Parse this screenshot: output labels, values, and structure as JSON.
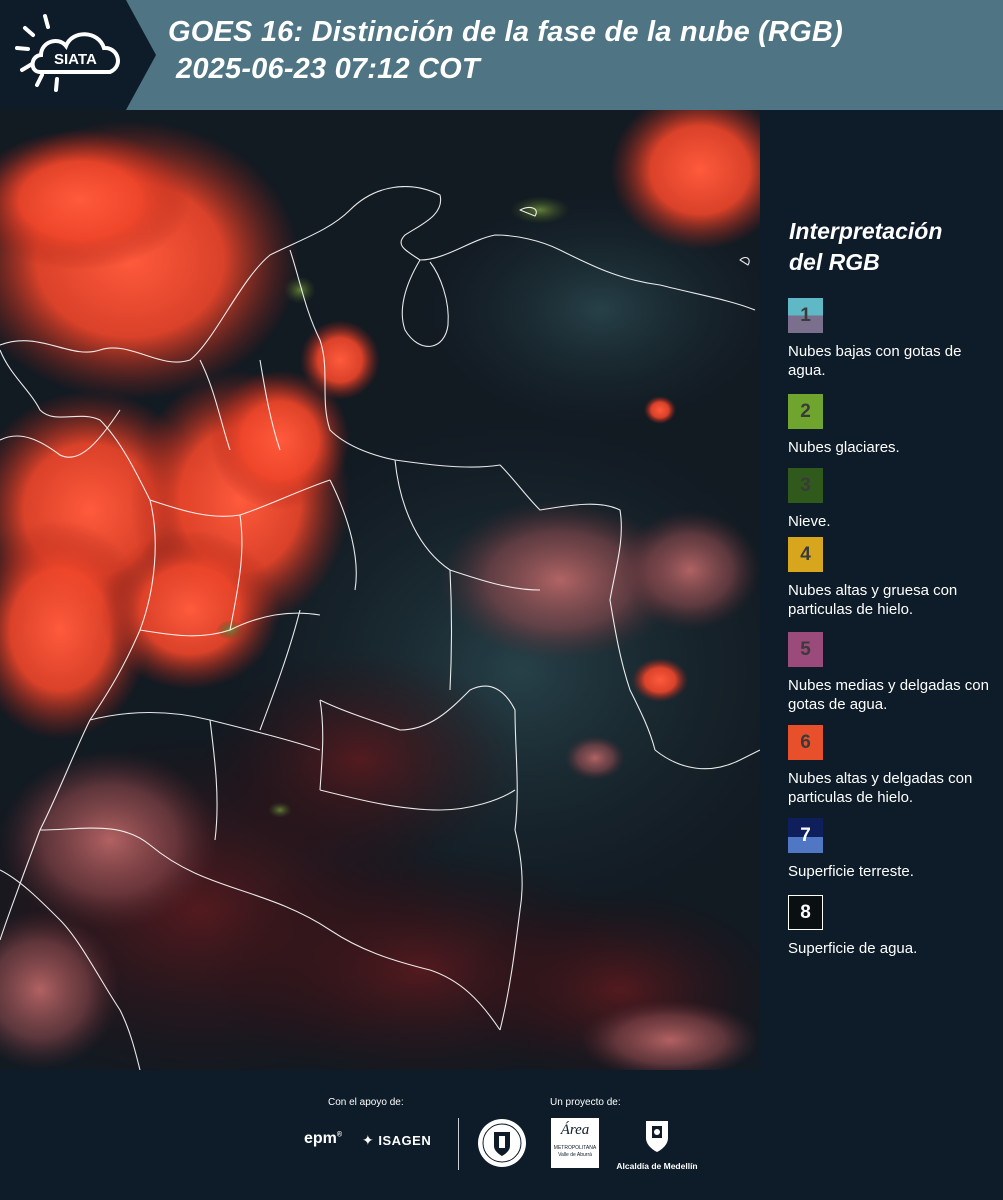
{
  "header": {
    "logo_text": "SIATA",
    "title_line1": "GOES 16: Distinción de la fase de la nube (RGB)",
    "title_line2": "2025-06-23 07:12 COT",
    "logo_icon": "sun-cloud-icon"
  },
  "map": {
    "description_icon": "satellite-rgb-map"
  },
  "legend": {
    "title_line1": "Interpretación",
    "title_line2": "del RGB",
    "items": [
      {
        "number": "1",
        "label": "Nubes bajas con gotas de agua.",
        "color_top": "#5fb8c6",
        "color_bottom": "#7a6f8c"
      },
      {
        "number": "2",
        "label": "Nubes glaciares.",
        "color": "#6fa52f"
      },
      {
        "number": "3",
        "label": "Nieve.",
        "color": "#2f5a1c"
      },
      {
        "number": "4",
        "label": "Nubes altas y gruesa con particulas de hielo.",
        "color": "#d8a61c"
      },
      {
        "number": "5",
        "label": "Nubes medias y delgadas con gotas de agua.",
        "color": "#9b4a7c"
      },
      {
        "number": "6",
        "label": "Nubes altas y delgadas con particulas de hielo.",
        "color": "#e8502c"
      },
      {
        "number": "7",
        "label": "Superficie terreste.",
        "color_top": "#0f1f5c",
        "color_bottom": "#4f77c4"
      },
      {
        "number": "8",
        "label": "Superficie de agua.",
        "color": "#0a0f12"
      }
    ]
  },
  "footer": {
    "support_label": "Con el apoyo de:",
    "project_label": "Un proyecto de:",
    "epm": "epm",
    "isagen": "ISAGEN",
    "area_line1": "Área",
    "area_line2": "METROPOLITANA",
    "area_line3": "Valle de Aburrá",
    "alcaldia": "Alcaldía de Medellín"
  }
}
